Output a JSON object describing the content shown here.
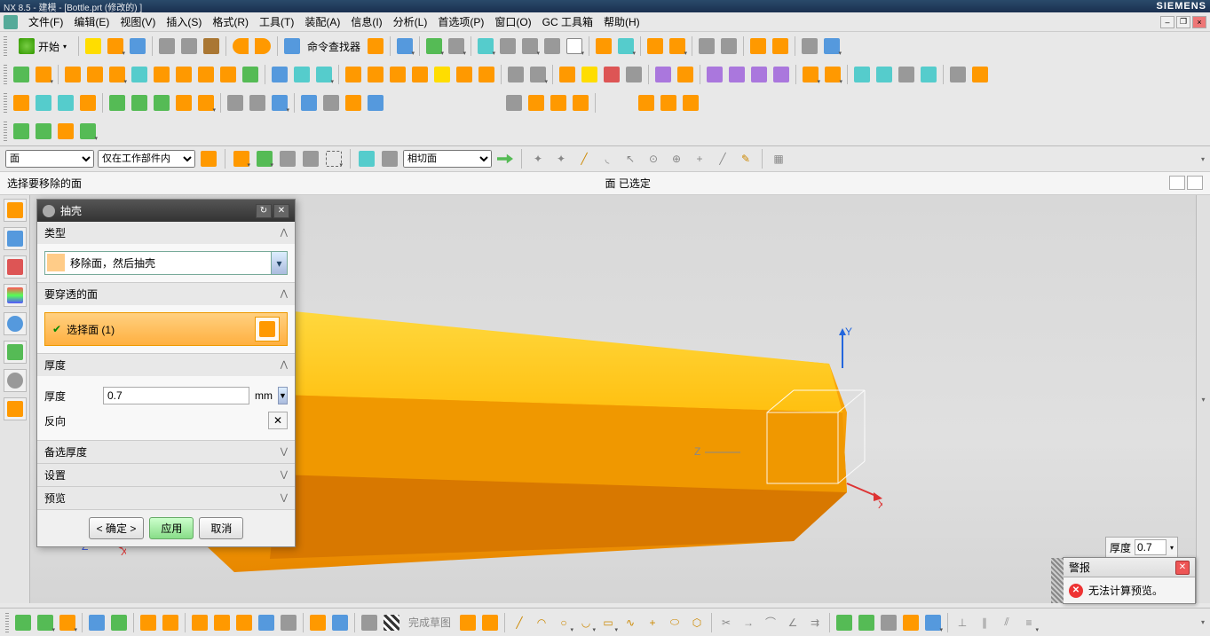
{
  "title_bar": {
    "title": "NX 8.5 - 建模 - [Bottle.prt (修改的) ]",
    "brand": "SIEMENS"
  },
  "menu": {
    "items": [
      "文件(F)",
      "编辑(E)",
      "视图(V)",
      "插入(S)",
      "格式(R)",
      "工具(T)",
      "装配(A)",
      "信息(I)",
      "分析(L)",
      "首选项(P)",
      "窗口(O)",
      "GC 工具箱",
      "帮助(H)"
    ]
  },
  "start_label": "开始",
  "cmd_finder_label": "命令查找器",
  "filters": {
    "type_filter": "面",
    "scope_filter": "仅在工作部件内",
    "snap_filter": "相切面"
  },
  "hint": {
    "left": "选择要移除的面",
    "right": "面  已选定"
  },
  "dialog": {
    "title": "抽壳",
    "sec_type": "类型",
    "type_option": "移除面，然后抽壳",
    "sec_pierce": "要穿透的面",
    "select_face": "选择面 (1)",
    "sec_thick": "厚度",
    "thick_label": "厚度",
    "thick_value": "0.7",
    "thick_unit": "mm",
    "reverse_label": "反向",
    "sec_alt": "备选厚度",
    "sec_settings": "设置",
    "sec_preview": "预览",
    "btn_ok": "< 确定 >",
    "btn_apply": "应用",
    "btn_cancel": "取消"
  },
  "thick_popup": {
    "label": "厚度",
    "value": "0.7"
  },
  "alarm": {
    "title": "警报",
    "msg": "无法计算预览。"
  },
  "sketch_done": "完成草图",
  "axes": {
    "x": "X",
    "y": "Y",
    "z": "Z"
  }
}
